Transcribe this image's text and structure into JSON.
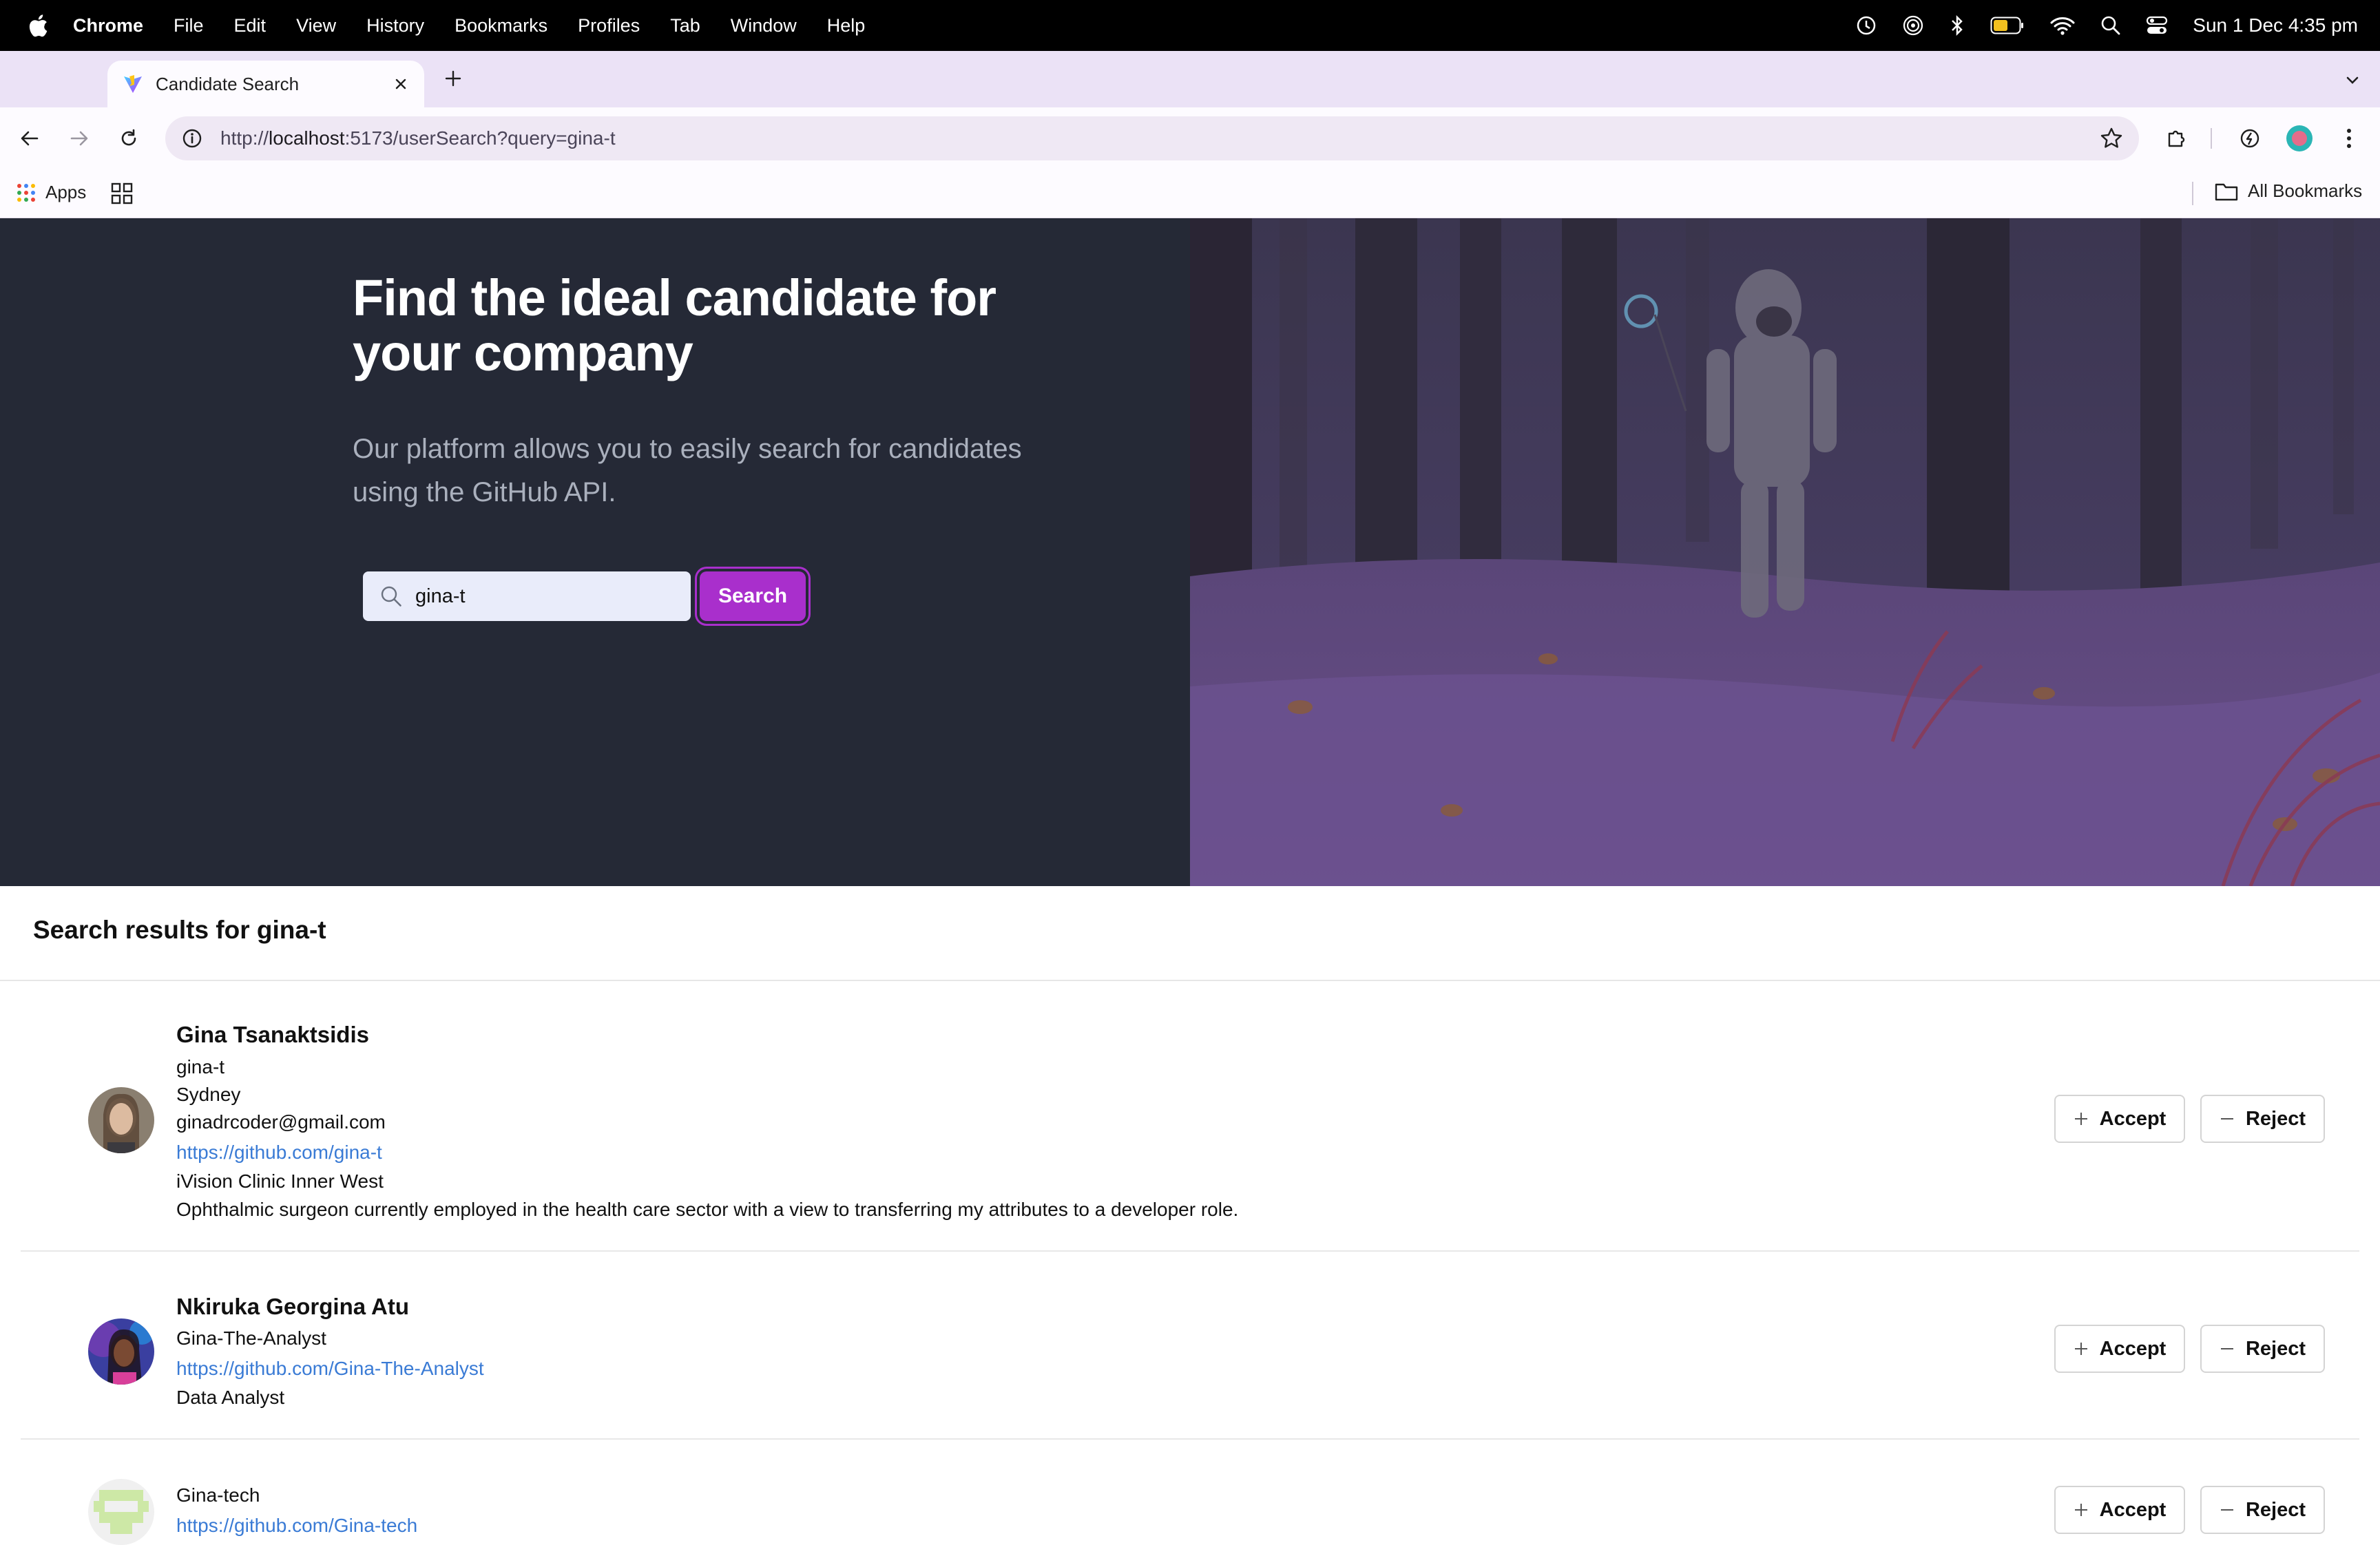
{
  "menubar": {
    "app_name": "Chrome",
    "items": [
      "File",
      "Edit",
      "View",
      "History",
      "Bookmarks",
      "Profiles",
      "Tab",
      "Window",
      "Help"
    ],
    "clock": "Sun 1 Dec  4:35 pm"
  },
  "browser": {
    "tab_title": "Candidate Search",
    "url_prefix": "http://",
    "url_host": "localhost",
    "url_rest": ":5173/userSearch?query=gina-t",
    "bookmarks": {
      "apps_label": "Apps",
      "all_bookmarks_label": "All Bookmarks"
    }
  },
  "hero": {
    "heading": "Find the ideal candidate for your company",
    "subheading": "Our platform allows you to easily search for candidates using the GitHub API.",
    "search": {
      "value": "gina-t",
      "button_label": "Search"
    }
  },
  "results": {
    "heading": "Search results for gina-t",
    "accept_label": "Accept",
    "reject_label": "Reject",
    "candidates": [
      {
        "name": "Gina Tsanaktsidis",
        "username": "gina-t",
        "location": "Sydney",
        "email": "ginadrcoder@gmail.com",
        "github_url": "https://github.com/gina-t",
        "company": "iVision Clinic Inner West",
        "bio": "Ophthalmic surgeon currently employed in the health care sector with a view to transferring my attributes to a developer role."
      },
      {
        "name": "Nkiruka Georgina Atu",
        "username": "Gina-The-Analyst",
        "github_url": "https://github.com/Gina-The-Analyst",
        "bio": "Data Analyst"
      },
      {
        "username": "Gina-tech",
        "github_url": "https://github.com/Gina-tech"
      }
    ]
  },
  "colors": {
    "accent": "#a92fcc",
    "hero_bg": "#252936",
    "link": "#3a7bd5"
  }
}
